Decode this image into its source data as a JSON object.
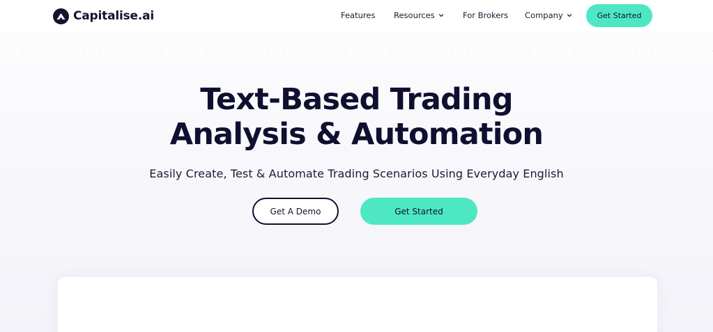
{
  "brand": {
    "name": "Capitalise.ai",
    "logo_icon": "capitalise-logo-icon"
  },
  "nav": {
    "items": [
      {
        "label": "Features",
        "has_dropdown": false
      },
      {
        "label": "Resources",
        "has_dropdown": true
      },
      {
        "label": "For Brokers",
        "has_dropdown": false
      },
      {
        "label": "Company",
        "has_dropdown": true
      }
    ],
    "cta_label": "Get Started"
  },
  "hero": {
    "title_line1": "Text-Based Trading",
    "title_line2": "Analysis & Automation",
    "subtitle": "Easily Create, Test & Automate Trading Scenarios Using Everyday English",
    "demo_label": "Get A Demo",
    "start_label": "Get Started"
  },
  "colors": {
    "accent": "#4de8c3",
    "text_dark": "#0f1030",
    "background": "#f6f6fb"
  }
}
